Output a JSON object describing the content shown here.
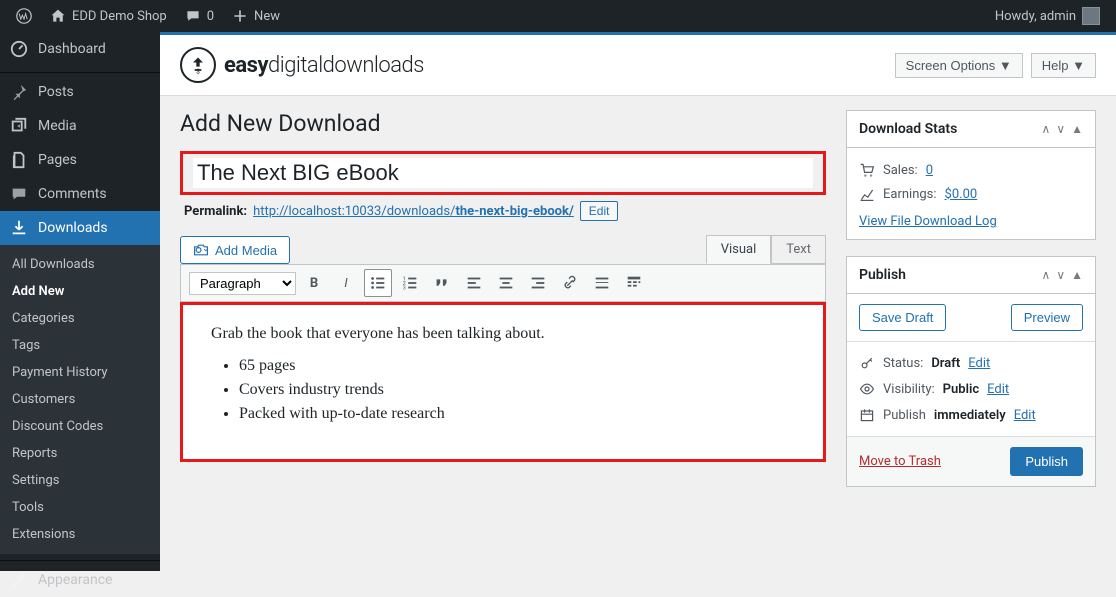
{
  "adminbar": {
    "site_name": "EDD Demo Shop",
    "comments_count": "0",
    "new_label": "New",
    "howdy": "Howdy, admin"
  },
  "sidebar": {
    "items": [
      {
        "label": "Dashboard",
        "icon": "dashboard"
      },
      {
        "label": "Posts",
        "icon": "pin"
      },
      {
        "label": "Media",
        "icon": "media"
      },
      {
        "label": "Pages",
        "icon": "pages"
      },
      {
        "label": "Comments",
        "icon": "comment"
      },
      {
        "label": "Downloads",
        "icon": "download",
        "current": true
      },
      {
        "label": "Appearance",
        "icon": "brush"
      }
    ],
    "submenu": [
      {
        "label": "All Downloads"
      },
      {
        "label": "Add New",
        "current": true
      },
      {
        "label": "Categories"
      },
      {
        "label": "Tags"
      },
      {
        "label": "Payment History"
      },
      {
        "label": "Customers"
      },
      {
        "label": "Discount Codes"
      },
      {
        "label": "Reports"
      },
      {
        "label": "Settings"
      },
      {
        "label": "Tools"
      },
      {
        "label": "Extensions"
      }
    ]
  },
  "header": {
    "brand_bold": "easy",
    "brand_light": "digitaldownloads",
    "screen_options": "Screen Options",
    "help": "Help"
  },
  "main": {
    "page_title": "Add New Download",
    "title_value": "The Next BIG eBook",
    "permalink_label": "Permalink:",
    "permalink_base": "http://localhost:10033/downloads/",
    "permalink_slug": "the-next-big-ebook/",
    "permalink_edit": "Edit",
    "add_media": "Add Media",
    "tabs": {
      "visual": "Visual",
      "text": "Text"
    },
    "format_select": "Paragraph",
    "content": {
      "intro": "Grab the book that everyone has been talking about.",
      "bullets": [
        "65 pages",
        "Covers industry trends",
        "Packed with up-to-date research"
      ]
    }
  },
  "stats_box": {
    "title": "Download Stats",
    "sales_label": "Sales:",
    "sales_value": "0",
    "earnings_label": "Earnings:",
    "earnings_value": "$0.00",
    "log_link": "View File Download Log"
  },
  "publish_box": {
    "title": "Publish",
    "save_draft": "Save Draft",
    "preview": "Preview",
    "status_label": "Status:",
    "status_value": "Draft",
    "visibility_label": "Visibility:",
    "visibility_value": "Public",
    "schedule_label": "Publish",
    "schedule_value": "immediately",
    "edit": "Edit",
    "trash": "Move to Trash",
    "publish_btn": "Publish"
  }
}
